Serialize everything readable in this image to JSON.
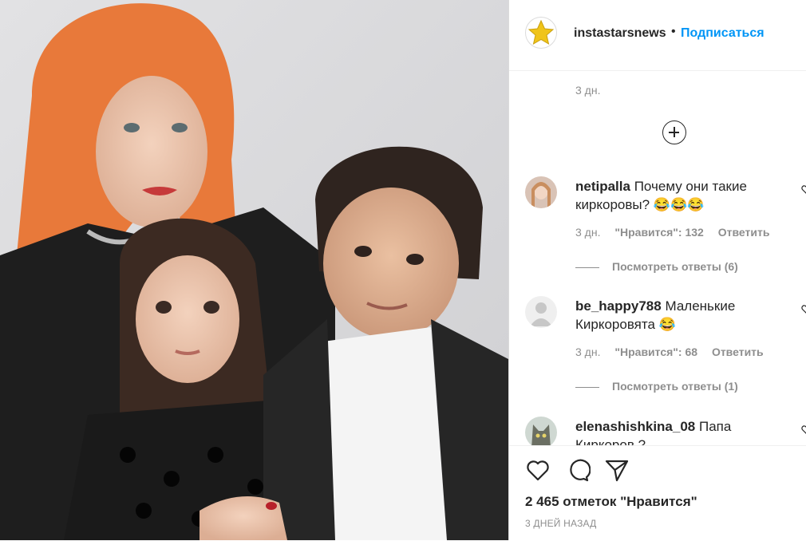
{
  "header": {
    "username": "instastarsnews",
    "separator": "•",
    "follow_label": "Подписаться",
    "avatar_icon": "star-icon"
  },
  "caption": {
    "time": "3 дн."
  },
  "load_more_icon": "plus-circle-icon",
  "comments": [
    {
      "username": "netipalla",
      "text": "Почему они такие киркоровы? 😂😂😂",
      "time": "3 дн.",
      "likes": "\"Нравится\": 132",
      "reply_label": "Ответить",
      "view_replies": "Посмотреть ответы (6)"
    },
    {
      "username": "be_happy788",
      "text": "Маленькие Киркоровята 😂",
      "time": "3 дн.",
      "likes": "\"Нравится\": 68",
      "reply_label": "Ответить",
      "view_replies": "Посмотреть ответы (1)"
    },
    {
      "username": "elenashishkina_08",
      "text": "Папа Киркоров ?"
    }
  ],
  "actions": {
    "like_icon": "heart-icon",
    "comment_icon": "comment-icon",
    "share_icon": "share-icon",
    "likes_total": "2 465 отметок \"Нравится\"",
    "date": "3 ДНЕЙ НАЗАД"
  },
  "colors": {
    "accent": "#0095f6",
    "muted": "#8e8e8e",
    "text": "#262626",
    "border": "#dbdbdb"
  }
}
